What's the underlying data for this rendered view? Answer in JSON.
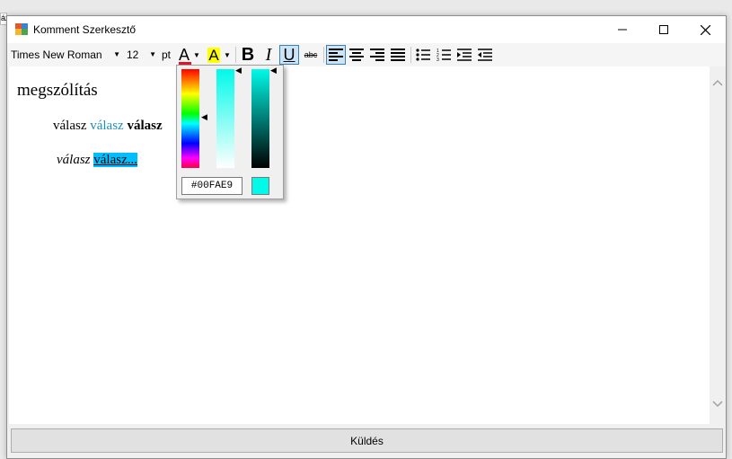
{
  "window": {
    "title": "Komment Szerkesztő"
  },
  "background_tab_text": "áz",
  "toolbar": {
    "font_name": "Times New Roman",
    "font_size": "12",
    "unit": "pt",
    "font_color_letter": "A",
    "highlight_letter": "A",
    "bold_letter": "B",
    "italic_letter": "I",
    "underline_letter": "U",
    "strike_label": "abc",
    "font_color": "#E81123",
    "highlight_color": "#FFFF00"
  },
  "editor": {
    "line1": "megszólítás",
    "line2": [
      "válasz",
      "válasz",
      "válasz"
    ],
    "line3": [
      "válasz",
      "válasz..."
    ],
    "link_color": "#1E90B8",
    "highlight_bg": "#00BFFF"
  },
  "color_picker": {
    "hex_value": "#00FAE9",
    "selected_color": "#00FAE9"
  },
  "send_button": {
    "label": "Küldés"
  }
}
